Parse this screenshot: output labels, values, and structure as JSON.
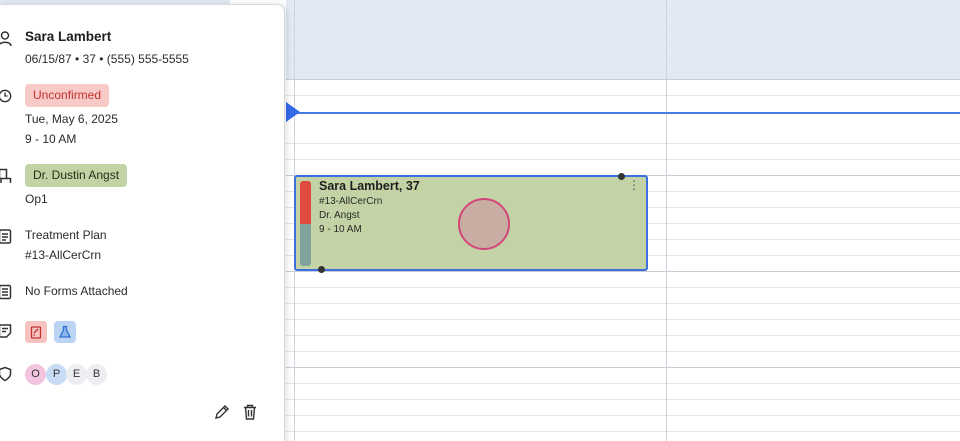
{
  "patient": {
    "name": "Sara Lambert",
    "details": "06/15/87 • 37 • (555) 555-5555"
  },
  "appointment": {
    "status": "Unconfirmed",
    "date": "Tue, May 6, 2025",
    "time": "9 - 10 AM",
    "provider": "Dr. Dustin Angst",
    "operatory": "Op1"
  },
  "treatment": {
    "label": "Treatment Plan",
    "code": "#13-AllCerCrn"
  },
  "forms": {
    "label": "No Forms Attached"
  },
  "insurance_badges": [
    "O",
    "P",
    "E",
    "B"
  ],
  "calendar_block": {
    "title": "Sara Lambert, 37",
    "code": "#13-AllCerCrn",
    "provider": "Dr. Angst",
    "time": "9 - 10 AM",
    "kebab": "⋮"
  },
  "colors": {
    "status_bg": "#f7c9c7",
    "status_text": "#c2342c",
    "provider_bg": "#c4d3a5",
    "appointment_bg": "#c4d3a5",
    "accent": "#3d6fe0",
    "now_line": "#4a7be3"
  },
  "icons": {
    "patient": "person-icon",
    "time": "clock-icon",
    "provider": "chair-icon",
    "treatment": "clipboard-icon",
    "forms": "forms-icon",
    "notes": "note-icon",
    "insurance": "shield-icon",
    "edit": "pencil-icon",
    "delete": "trash-icon"
  }
}
